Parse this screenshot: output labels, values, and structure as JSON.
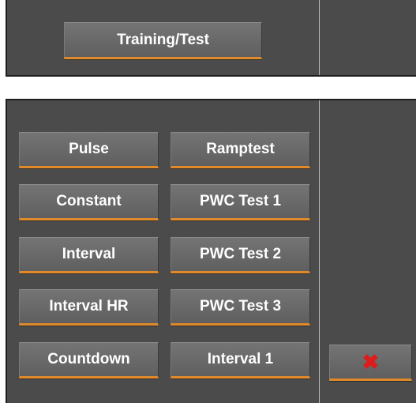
{
  "header": {
    "mode_button_label": "Training/Test"
  },
  "programs": {
    "left": [
      "Pulse",
      "Constant",
      "Interval",
      "Interval HR",
      "Countdown"
    ],
    "right": [
      "Ramptest",
      "PWC Test 1",
      "PWC Test 2",
      "PWC Test 3",
      "Interval 1"
    ]
  },
  "close": {
    "icon": "close-icon",
    "glyph": "✖",
    "color": "#e01b1b"
  },
  "colors": {
    "panel": "#4b4b4b",
    "button": "#6a6a6a",
    "accent": "#e08a2a"
  }
}
